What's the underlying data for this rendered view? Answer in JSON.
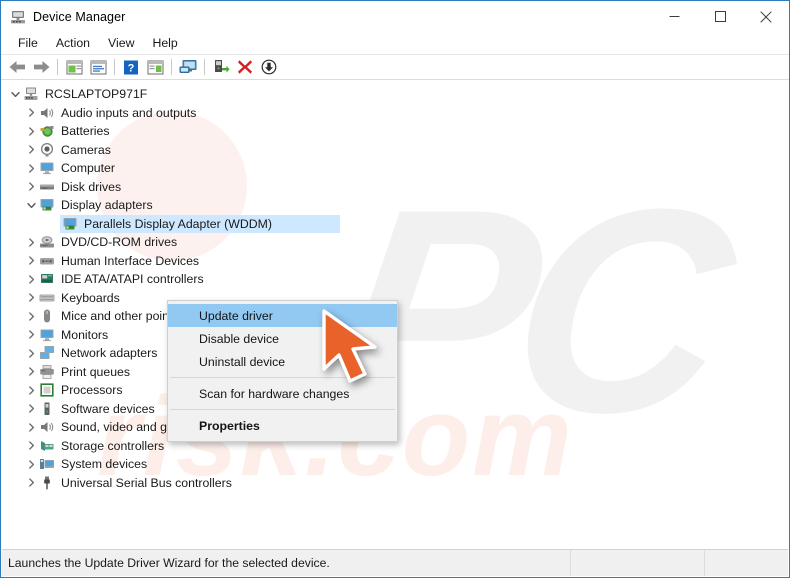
{
  "window": {
    "title": "Device Manager",
    "icon": "device-manager-icon",
    "controls": {
      "minimize": "–",
      "maximize": "□",
      "close": "✕"
    }
  },
  "menubar": {
    "items": [
      {
        "label": "File",
        "name": "menu-file"
      },
      {
        "label": "Action",
        "name": "menu-action"
      },
      {
        "label": "View",
        "name": "menu-view"
      },
      {
        "label": "Help",
        "name": "menu-help"
      }
    ]
  },
  "toolbar": {
    "buttons": [
      {
        "name": "back-button",
        "icon": "back-arrow-icon"
      },
      {
        "name": "forward-button",
        "icon": "forward-arrow-icon"
      },
      {
        "name": "separator-1",
        "icon": "separator"
      },
      {
        "name": "show-hide-console-tree-button",
        "icon": "console-tree-icon"
      },
      {
        "name": "properties-button",
        "icon": "properties-window-icon"
      },
      {
        "name": "separator-2",
        "icon": "separator"
      },
      {
        "name": "help-button",
        "icon": "help-question-icon"
      },
      {
        "name": "show-hide-action-pane-button",
        "icon": "action-pane-icon"
      },
      {
        "name": "separator-3",
        "icon": "separator"
      },
      {
        "name": "scan-for-hardware-changes-button",
        "icon": "monitor-scan-icon"
      },
      {
        "name": "separator-4",
        "icon": "separator"
      },
      {
        "name": "update-driver-button",
        "icon": "update-driver-icon"
      },
      {
        "name": "uninstall-device-button",
        "icon": "red-x-icon"
      },
      {
        "name": "disable-device-button",
        "icon": "down-arrow-circle-icon"
      }
    ]
  },
  "tree": {
    "root": {
      "label": "RCSLAPTOP971F",
      "icon": "computer-root-icon",
      "expanded": true
    },
    "nodes": [
      {
        "label": "Audio inputs and outputs",
        "icon": "speaker-icon",
        "expanded": false,
        "level": 1
      },
      {
        "label": "Batteries",
        "icon": "battery-icon",
        "expanded": false,
        "level": 1
      },
      {
        "label": "Cameras",
        "icon": "camera-icon",
        "expanded": false,
        "level": 1
      },
      {
        "label": "Computer",
        "icon": "monitor-icon",
        "expanded": false,
        "level": 1
      },
      {
        "label": "Disk drives",
        "icon": "disk-drive-icon",
        "expanded": false,
        "level": 1
      },
      {
        "label": "Display adapters",
        "icon": "display-adapter-icon",
        "expanded": true,
        "level": 1
      },
      {
        "label": "Parallels Display Adapter (WDDM)",
        "icon": "display-adapter-icon",
        "level": 2,
        "selected": true
      },
      {
        "label": "DVD/CD-ROM drives",
        "icon": "dvd-drive-icon",
        "expanded": false,
        "level": 1
      },
      {
        "label": "Human Interface Devices",
        "icon": "hid-icon",
        "expanded": false,
        "level": 1
      },
      {
        "label": "IDE ATA/ATAPI controllers",
        "icon": "ide-controller-icon",
        "expanded": false,
        "level": 1
      },
      {
        "label": "Keyboards",
        "icon": "keyboard-icon",
        "expanded": false,
        "level": 1
      },
      {
        "label": "Mice and other pointing devices",
        "icon": "mouse-icon",
        "expanded": false,
        "level": 1
      },
      {
        "label": "Monitors",
        "icon": "monitor-icon",
        "expanded": false,
        "level": 1
      },
      {
        "label": "Network adapters",
        "icon": "network-adapter-icon",
        "expanded": false,
        "level": 1
      },
      {
        "label": "Print queues",
        "icon": "printer-icon",
        "expanded": false,
        "level": 1
      },
      {
        "label": "Processors",
        "icon": "processor-icon",
        "expanded": false,
        "level": 1
      },
      {
        "label": "Software devices",
        "icon": "software-device-icon",
        "expanded": false,
        "level": 1
      },
      {
        "label": "Sound, video and game controllers",
        "icon": "speaker-icon",
        "expanded": false,
        "level": 1
      },
      {
        "label": "Storage controllers",
        "icon": "storage-controller-icon",
        "expanded": false,
        "level": 1
      },
      {
        "label": "System devices",
        "icon": "system-device-icon",
        "expanded": false,
        "level": 1
      },
      {
        "label": "Universal Serial Bus controllers",
        "icon": "usb-icon",
        "expanded": false,
        "level": 1
      }
    ]
  },
  "context_menu": {
    "items": [
      {
        "label": "Update driver",
        "name": "ctx-update-driver",
        "highlighted": true
      },
      {
        "label": "Disable device",
        "name": "ctx-disable-device",
        "highlighted": false
      },
      {
        "label": "Uninstall device",
        "name": "ctx-uninstall-device",
        "highlighted": false
      },
      {
        "label": "Scan for hardware changes",
        "name": "ctx-scan-for-hardware-changes",
        "highlighted": false
      },
      {
        "label": "Properties",
        "name": "ctx-properties",
        "highlighted": false,
        "bold": true
      }
    ]
  },
  "statusbar": {
    "message": "Launches the Update Driver Wizard for the selected device.",
    "pane2": "",
    "pane3": ""
  },
  "watermark": {
    "logo": "PC",
    "site": "risk.com"
  },
  "colors": {
    "selection": "#cde8ff",
    "menu_highlight": "#91c9f2",
    "cursor": "#e8622a",
    "window_border": "#2b7cbf",
    "statusbar_bg": "#f0f0f0"
  }
}
